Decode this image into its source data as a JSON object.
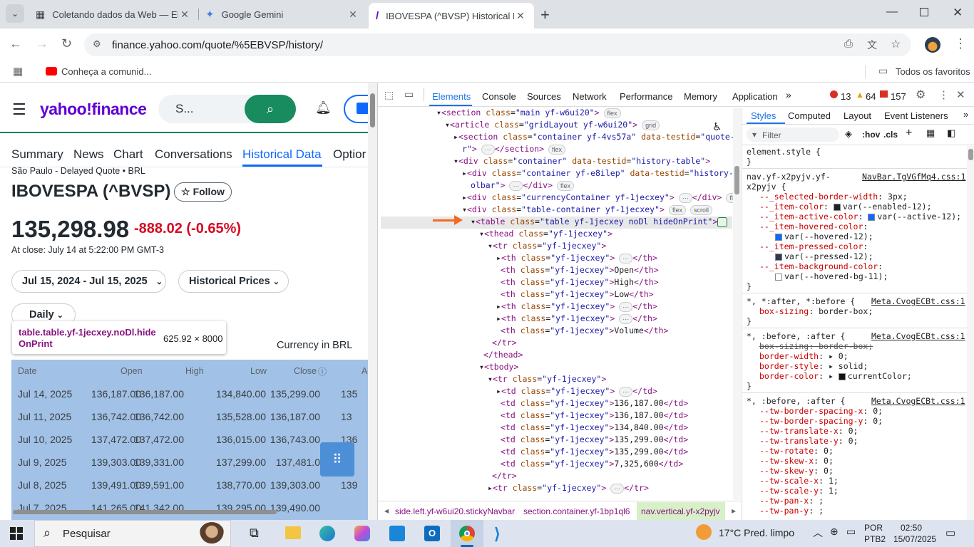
{
  "tabs": [
    {
      "title": "Coletando dados da Web — EB",
      "icon": "ebanx-icon"
    },
    {
      "title": "Google Gemini",
      "icon": "gemini-icon"
    },
    {
      "title": "IBOVESPA (^BVSP) Historical Da",
      "icon": "yahoo-icon"
    }
  ],
  "address": {
    "url": "finance.yahoo.com/quote/%5EBVSP/history/"
  },
  "bookmarks": {
    "item": "Conheça a comunid...",
    "all": "Todos os favoritos"
  },
  "yahoo": {
    "logo": "yahoo!finance",
    "search_placeholder": "S...",
    "nav": [
      "Summary",
      "News",
      "Chart",
      "Conversations",
      "Historical Data",
      "Optior"
    ],
    "exchange": "São Paulo - Delayed Quote • BRL",
    "name": "IBOVESPA (^BVSP)",
    "follow": "Follow",
    "price": "135,298.98",
    "change": "-888.02 (-0.65%)",
    "close_time": "At close: July 14 at 5:22:00 PM GMT-3",
    "date_range": "Jul 15, 2024 - Jul 15, 2025",
    "historical_prices": "Historical Prices",
    "frequency": "Daily",
    "currency": "Currency in BRL",
    "tooltip": {
      "selector": "table.table.yf-1jecxey.noDl.hide OnPrint",
      "size": "625.92 × 8000"
    },
    "columns": [
      "Date",
      "Open",
      "High",
      "Low",
      "Close",
      "Adj"
    ],
    "rows": [
      [
        "Jul 14, 2025",
        "136,187.00",
        "136,187.00",
        "134,840.00",
        "135,299.00",
        "135"
      ],
      [
        "Jul 11, 2025",
        "136,742.00",
        "136,742.00",
        "135,528.00",
        "136,187.00",
        "13"
      ],
      [
        "Jul 10, 2025",
        "137,472.00",
        "137,472.00",
        "136,015.00",
        "136,743.00",
        "136"
      ],
      [
        "Jul 9, 2025",
        "139,303.00",
        "139,331.00",
        "137,299.00",
        "137,481.0",
        ""
      ],
      [
        "Jul 8, 2025",
        "139,491.00",
        "139,591.00",
        "138,770.00",
        "139,303.00",
        "139"
      ],
      [
        "Jul 7, 2025",
        "141,265.00",
        "141,342.00",
        "139,295.00",
        "139,490.00",
        ""
      ]
    ]
  },
  "devtools": {
    "tabs": [
      "Elements",
      "Console",
      "Sources",
      "Network",
      "Performance",
      "Memory",
      "Application"
    ],
    "errors": "13",
    "warnings": "64",
    "issues": "157",
    "side_tabs": [
      "Styles",
      "Computed",
      "Layout",
      "Event Listeners"
    ],
    "filter_placeholder": "Filter",
    "hov": ":hov",
    "cls": ".cls",
    "breadcrumbs": [
      "side.left.yf-w6ui20.stickyNavbar",
      "section.container.yf-1bp1ql6",
      "nav.vertical.yf-x2pyjv"
    ]
  },
  "taskbar": {
    "search": "Pesquisar",
    "weather": "17°C  Pred. limpo",
    "lang1": "POR",
    "lang2": "PTB2",
    "time": "02:50",
    "date": "15/07/2025"
  }
}
